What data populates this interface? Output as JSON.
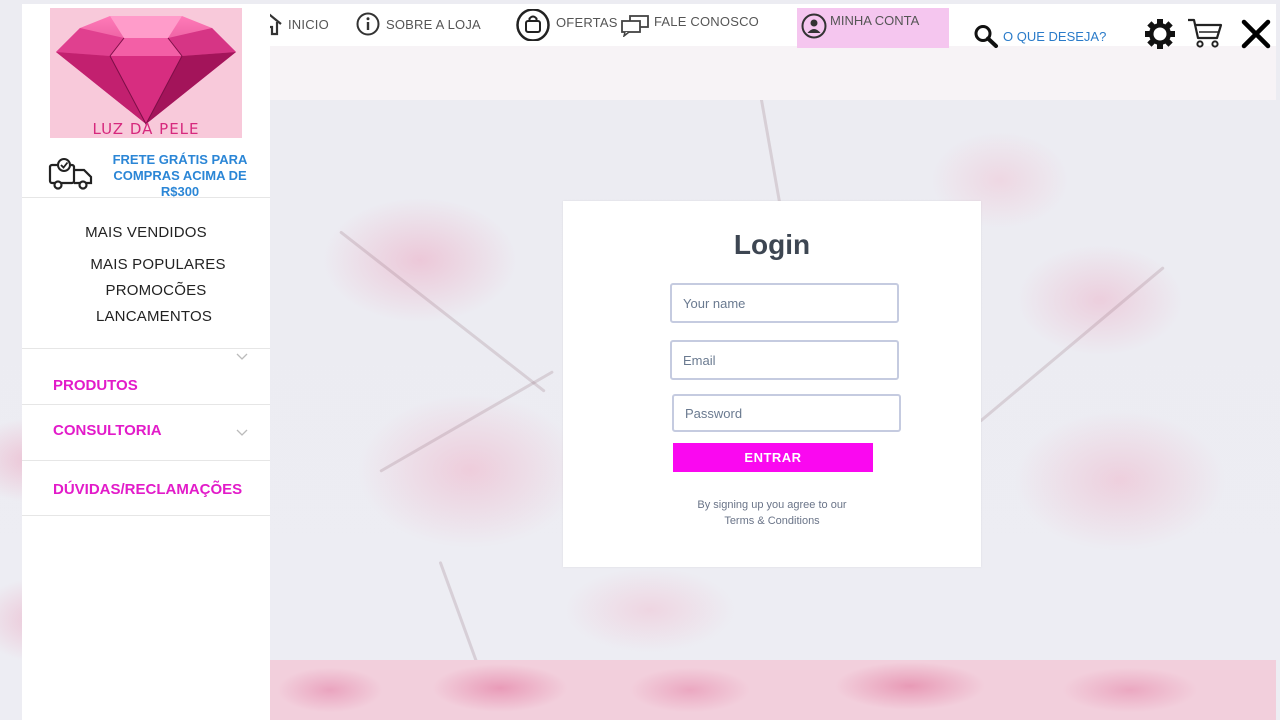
{
  "brand": {
    "logo_text": "LUZ DA PELE",
    "shipping_text": "FRETE GRÁTIS PARA COMPRAS ACIMA DE R$300"
  },
  "topnav": {
    "items": [
      {
        "label": "INICIO",
        "icon": "home-icon"
      },
      {
        "label": "SOBRE A LOJA",
        "icon": "info-icon"
      },
      {
        "label": "OFERTAS",
        "icon": "bag-icon"
      },
      {
        "label": "FALE CONOSCO",
        "icon": "chat-icon"
      },
      {
        "label": "MINHA CONTA",
        "icon": "user-icon"
      }
    ],
    "search_label": "O QUE DESEJA?",
    "active_color": "#f5c6ef"
  },
  "sidebar": {
    "quick_links": [
      "MAIS VENDIDOS",
      "MAIS POPULARES",
      "PROMOCÕES",
      "LANCAMENTOS"
    ],
    "menu": [
      "PRODUTOS",
      "CONSULTORIA",
      "DÚVIDAS/RECLAMAÇÕES"
    ],
    "menu_color": "#e21bc9"
  },
  "login": {
    "title": "Login",
    "name_placeholder": "Your name",
    "email_placeholder": "Email",
    "password_placeholder": "Password",
    "submit_label": "ENTRAR",
    "terms_line1": "By signing up you agree to our",
    "terms_line2": "Terms & Conditions",
    "button_color": "#fa08f0"
  }
}
